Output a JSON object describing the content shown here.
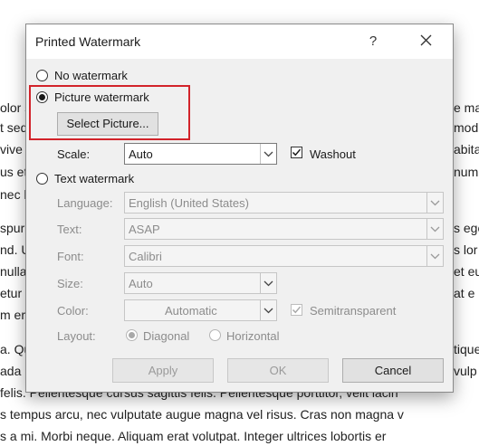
{
  "document": {
    "lines": [
      "olor s",
      "t sed",
      "vive",
      "us et",
      "nec l",
      "e ma",
      "mod",
      "abita",
      "num",
      "spur",
      "nd. U",
      "nulla",
      "etur",
      "m er",
      "s ege",
      "s lor",
      "et eu",
      "at e",
      "a. Qu",
      "ada",
      "tique",
      "vulp",
      "felis. Pellentesque cursus sagittis felis. Pellentesque porttitor, velit lacin",
      "s tempus arcu, nec vulputate augue magna vel risus. Cras non magna v",
      "s a mi. Morbi neque. Aliquam erat volutpat. Integer ultrices lobortis er"
    ]
  },
  "dialog": {
    "title": "Printed Watermark",
    "help_label": "?",
    "no_watermark_label": "No watermark",
    "picture_watermark_label": "Picture watermark",
    "select_picture_label": "Select Picture...",
    "scale_label": "Scale:",
    "scale_value": "Auto",
    "washout_label": "Washout",
    "washout_checked": true,
    "text_watermark_label": "Text watermark",
    "language_label": "Language:",
    "language_value": "English (United States)",
    "text_label": "Text:",
    "text_value": "ASAP",
    "font_label": "Font:",
    "font_value": "Calibri",
    "size_label": "Size:",
    "size_value": "Auto",
    "color_label": "Color:",
    "color_value": "Automatic",
    "semitransparent_label": "Semitransparent",
    "semitransparent_checked": true,
    "layout_label": "Layout:",
    "diagonal_label": "Diagonal",
    "horizontal_label": "Horizontal",
    "apply_label": "Apply",
    "ok_label": "OK",
    "cancel_label": "Cancel",
    "selected_option": "Picture watermark",
    "highlight_color": "#d2232a"
  }
}
